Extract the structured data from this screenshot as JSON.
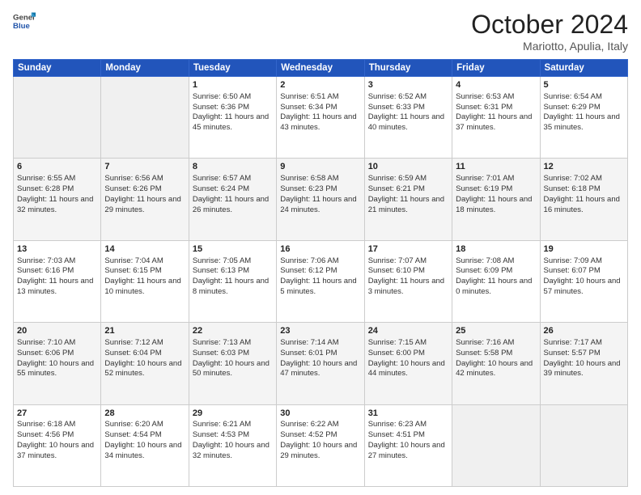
{
  "header": {
    "logo": {
      "general": "General",
      "blue": "Blue"
    },
    "title": "October 2024",
    "subtitle": "Mariotto, Apulia, Italy"
  },
  "calendar": {
    "weekdays": [
      "Sunday",
      "Monday",
      "Tuesday",
      "Wednesday",
      "Thursday",
      "Friday",
      "Saturday"
    ],
    "weeks": [
      [
        {
          "day": null
        },
        {
          "day": null
        },
        {
          "day": 1,
          "sunrise": "6:50 AM",
          "sunset": "6:36 PM",
          "daylight": "11 hours and 45 minutes."
        },
        {
          "day": 2,
          "sunrise": "6:51 AM",
          "sunset": "6:34 PM",
          "daylight": "11 hours and 43 minutes."
        },
        {
          "day": 3,
          "sunrise": "6:52 AM",
          "sunset": "6:33 PM",
          "daylight": "11 hours and 40 minutes."
        },
        {
          "day": 4,
          "sunrise": "6:53 AM",
          "sunset": "6:31 PM",
          "daylight": "11 hours and 37 minutes."
        },
        {
          "day": 5,
          "sunrise": "6:54 AM",
          "sunset": "6:29 PM",
          "daylight": "11 hours and 35 minutes."
        }
      ],
      [
        {
          "day": 6,
          "sunrise": "6:55 AM",
          "sunset": "6:28 PM",
          "daylight": "11 hours and 32 minutes."
        },
        {
          "day": 7,
          "sunrise": "6:56 AM",
          "sunset": "6:26 PM",
          "daylight": "11 hours and 29 minutes."
        },
        {
          "day": 8,
          "sunrise": "6:57 AM",
          "sunset": "6:24 PM",
          "daylight": "11 hours and 26 minutes."
        },
        {
          "day": 9,
          "sunrise": "6:58 AM",
          "sunset": "6:23 PM",
          "daylight": "11 hours and 24 minutes."
        },
        {
          "day": 10,
          "sunrise": "6:59 AM",
          "sunset": "6:21 PM",
          "daylight": "11 hours and 21 minutes."
        },
        {
          "day": 11,
          "sunrise": "7:01 AM",
          "sunset": "6:19 PM",
          "daylight": "11 hours and 18 minutes."
        },
        {
          "day": 12,
          "sunrise": "7:02 AM",
          "sunset": "6:18 PM",
          "daylight": "11 hours and 16 minutes."
        }
      ],
      [
        {
          "day": 13,
          "sunrise": "7:03 AM",
          "sunset": "6:16 PM",
          "daylight": "11 hours and 13 minutes."
        },
        {
          "day": 14,
          "sunrise": "7:04 AM",
          "sunset": "6:15 PM",
          "daylight": "11 hours and 10 minutes."
        },
        {
          "day": 15,
          "sunrise": "7:05 AM",
          "sunset": "6:13 PM",
          "daylight": "11 hours and 8 minutes."
        },
        {
          "day": 16,
          "sunrise": "7:06 AM",
          "sunset": "6:12 PM",
          "daylight": "11 hours and 5 minutes."
        },
        {
          "day": 17,
          "sunrise": "7:07 AM",
          "sunset": "6:10 PM",
          "daylight": "11 hours and 3 minutes."
        },
        {
          "day": 18,
          "sunrise": "7:08 AM",
          "sunset": "6:09 PM",
          "daylight": "11 hours and 0 minutes."
        },
        {
          "day": 19,
          "sunrise": "7:09 AM",
          "sunset": "6:07 PM",
          "daylight": "10 hours and 57 minutes."
        }
      ],
      [
        {
          "day": 20,
          "sunrise": "7:10 AM",
          "sunset": "6:06 PM",
          "daylight": "10 hours and 55 minutes."
        },
        {
          "day": 21,
          "sunrise": "7:12 AM",
          "sunset": "6:04 PM",
          "daylight": "10 hours and 52 minutes."
        },
        {
          "day": 22,
          "sunrise": "7:13 AM",
          "sunset": "6:03 PM",
          "daylight": "10 hours and 50 minutes."
        },
        {
          "day": 23,
          "sunrise": "7:14 AM",
          "sunset": "6:01 PM",
          "daylight": "10 hours and 47 minutes."
        },
        {
          "day": 24,
          "sunrise": "7:15 AM",
          "sunset": "6:00 PM",
          "daylight": "10 hours and 44 minutes."
        },
        {
          "day": 25,
          "sunrise": "7:16 AM",
          "sunset": "5:58 PM",
          "daylight": "10 hours and 42 minutes."
        },
        {
          "day": 26,
          "sunrise": "7:17 AM",
          "sunset": "5:57 PM",
          "daylight": "10 hours and 39 minutes."
        }
      ],
      [
        {
          "day": 27,
          "sunrise": "6:18 AM",
          "sunset": "4:56 PM",
          "daylight": "10 hours and 37 minutes."
        },
        {
          "day": 28,
          "sunrise": "6:20 AM",
          "sunset": "4:54 PM",
          "daylight": "10 hours and 34 minutes."
        },
        {
          "day": 29,
          "sunrise": "6:21 AM",
          "sunset": "4:53 PM",
          "daylight": "10 hours and 32 minutes."
        },
        {
          "day": 30,
          "sunrise": "6:22 AM",
          "sunset": "4:52 PM",
          "daylight": "10 hours and 29 minutes."
        },
        {
          "day": 31,
          "sunrise": "6:23 AM",
          "sunset": "4:51 PM",
          "daylight": "10 hours and 27 minutes."
        },
        {
          "day": null
        },
        {
          "day": null
        }
      ]
    ]
  }
}
